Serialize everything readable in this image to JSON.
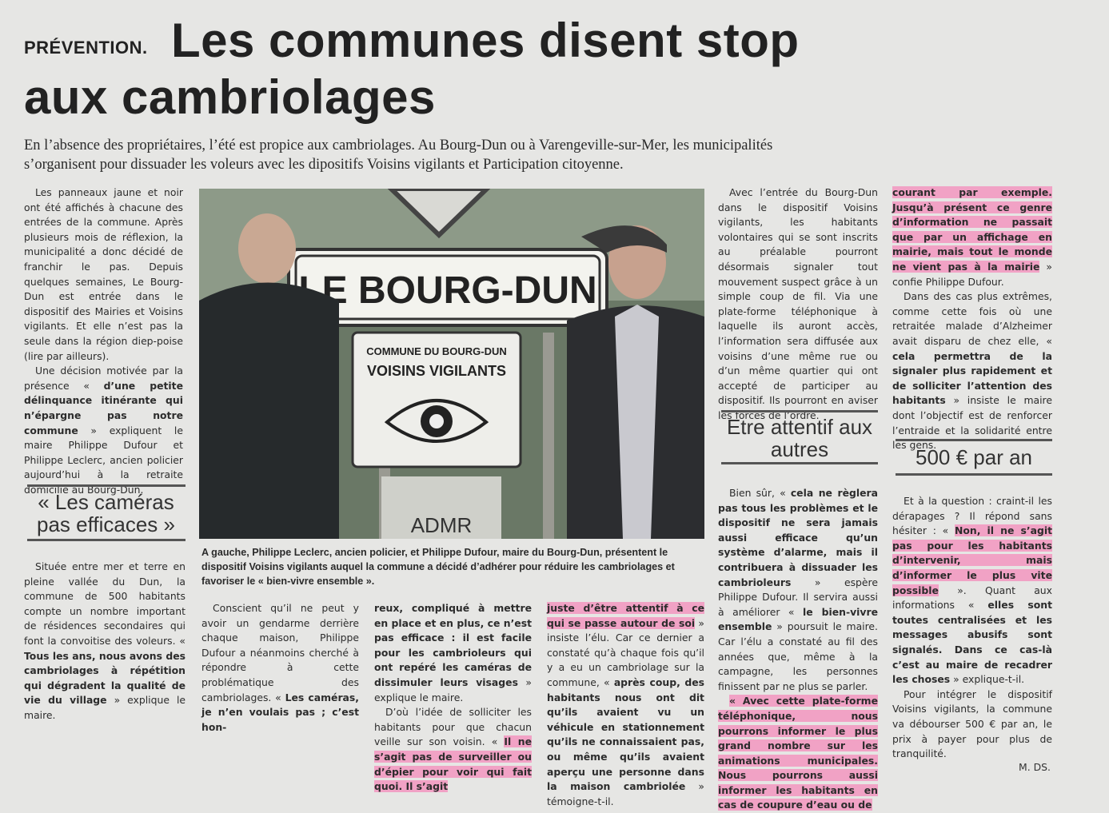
{
  "kicker": "PRÉVENTION.",
  "headline": {
    "line1": "Les communes disent stop",
    "line2": "aux cambriolages"
  },
  "lede": {
    "line1": "En l’absence des propriétaires, l’été est propice aux cambriolages. Au Bourg-Dun ou à Varengeville-sur-Mer, les municipalités",
    "line2": "s’organisent pour dissuader les voleurs avec les dipositifs Voisins vigilants et Participation citoyenne."
  },
  "col1": {
    "p1": "Les panneaux jaune et noir ont été affichés à chacune des entrées de la commune. Après plusieurs mois de réflexion, la municipalité a donc décidé de franchir le pas. Depuis quelques semaines, Le Bourg-Dun est entrée dans le dispositif des Mairies et Voisins vigilants. Et elle n’est pas la seule dans la région diep-poise (lire par ailleurs).",
    "p2a": "Une décision motivée par la présence « ",
    "p2b": "d’une petite délinquance itinérante qui n’épargne pas notre commune",
    "p2c": " » expliquent le maire Philippe Dufour et Philippe Leclerc, ancien policier aujourd’hui à la retraite domicilié au Bourg-Dun.",
    "subhead": "« Les caméras pas efficaces »",
    "p3a": "Située entre mer et terre en pleine vallée du Dun, la commune de 500 habitants compte un nombre important de résidences secondaires qui font la convoitise des voleurs. « ",
    "p3b": "Tous les ans, nous avons des cambriolages à répétition qui dégradent la qualité de vie du village",
    "p3c": " » explique le maire."
  },
  "photo": {
    "sign_main": "LE BOURG-DUN",
    "sign_small_line1": "COMMUNE DU BOURG-DUN",
    "sign_small_line2": "VOISINS VIGILANTS",
    "sign_bottom": "ADMR"
  },
  "caption": "A gauche, Philippe Leclerc, ancien policier, et Philippe Dufour, maire du Bourg-Dun, présentent le dispositif Voisins vigilants auquel la commune a décidé d’adhérer pour réduire les cambriolages et favoriser le « bien-vivre ensemble ».",
  "col2": {
    "p1a": "Conscient qu’il ne peut y avoir un gendarme derrière chaque maison, Philippe Dufour a néanmoins cherché à répondre à cette problématique des cambriolages. « ",
    "p1b": "Les caméras, je n’en voulais pas ; c’est hon-"
  },
  "col3": {
    "p1a": "reux, compliqué à mettre en place et en plus, ce n’est pas efficace : il est facile pour les cambrioleurs qui ont repéré les caméras de dissimuler leurs visages",
    "p1b": " » explique le maire.",
    "p2a": "D’où l’idée de solliciter les habitants pour que chacun veille sur son voisin. « ",
    "p2b": "Il ne s’agit pas de surveiller ou d’épier pour voir qui fait quoi. Il s’agit"
  },
  "col4": {
    "p1a": "juste d’être attentif à ce qui se passe autour de soi",
    "p1b": " » insiste l’élu. Car ce dernier a constaté qu’à chaque fois qu’il y a eu un cambriolage sur la commune, « ",
    "p1c": "après coup, des habitants nous ont dit qu’ils avaient vu un véhicule en stationnement qu’ils ne connaissaient pas, ou même qu’ils avaient aperçu une personne dans la maison cambriolée",
    "p1d": " » témoigne-t-il."
  },
  "col5": {
    "p1": "Avec l’entrée du Bourg-Dun dans le dispositif Voisins vigilants, les habitants volontaires qui se sont inscrits au préalable pourront désormais signaler tout mouvement suspect grâce à un simple coup de fil. Via une plate-forme téléphonique à laquelle ils auront accès, l’information sera diffusée aux voisins d’une même rue ou d’un même quartier qui ont accepté de participer au dispositif. Ils pourront en aviser les forces de l’ordre.",
    "subhead": "Etre attentif aux autres",
    "p2a": "Bien sûr, « ",
    "p2b": "cela ne règlera pas tous les problèmes et le dispositif ne sera jamais aussi efficace qu’un système d’alarme, mais il contribuera à dissuader les cambrioleurs",
    "p2c": " » espère Philippe Dufour. Il servira aussi à améliorer « ",
    "p2d": "le bien-vivre ensemble",
    "p2e": " » poursuit le maire. Car l’élu a constaté au fil des années que, même à la campagne, les personnes finissent par ne plus se parler.",
    "p3": "« Avec cette plate-forme téléphonique, nous pourrons informer le plus grand nombre sur les animations municipales. Nous pourrons aussi informer les habitants en cas de coupure d’eau ou de"
  },
  "col6": {
    "p1a": "courant par exemple. Jusqu’à présent ce genre d’information ne passait que par un affichage en mairie, mais tout le monde ne vient pas à la mairie",
    "p1b": " » confie Philippe Dufour.",
    "p2a": "Dans des cas plus extrêmes, comme cette fois où une retraitée malade d’Alzheimer avait disparu de chez elle, « ",
    "p2b": "cela permettra de la signaler plus rapidement et de solliciter l’attention des habitants",
    "p2c": " » insiste le maire dont l’objectif est de renforcer l’entraide et la solidarité entre les gens.",
    "subhead": "500 € par an",
    "p3a": "Et à la question : craint-il les dérapages ? Il répond sans hésiter : « ",
    "p3b": "Non, il ne s’agit pas pour les habitants d’intervenir, mais d’informer le plus vite possible",
    "p3c": " ». Quant aux informations « ",
    "p3d": "elles sont toutes centralisées et les messages abusifs sont signalés. Dans ce cas-là c’est au maire de recadrer les choses",
    "p3e": " » explique-t-il.",
    "p4": "Pour intégrer le dispositif Voisins vigilants, la commune va débourser 500 € par an, le prix à payer pour plus de tranquilité.",
    "signature": "M. DS."
  }
}
